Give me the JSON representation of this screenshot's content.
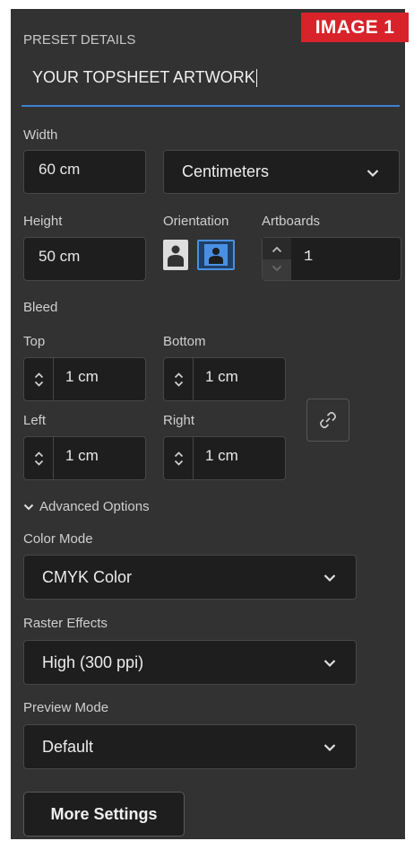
{
  "badge": "IMAGE 1",
  "preset": {
    "header": "PRESET DETAILS",
    "name": "YOUR TOPSHEET ARTWORK"
  },
  "size": {
    "width_label": "Width",
    "width_value": "60 cm",
    "units": "Centimeters",
    "height_label": "Height",
    "height_value": "50 cm",
    "orientation_label": "Orientation",
    "artboards_label": "Artboards",
    "artboards_value": "1"
  },
  "bleed": {
    "label": "Bleed",
    "top_label": "Top",
    "top_value": "1 cm",
    "bottom_label": "Bottom",
    "bottom_value": "1 cm",
    "left_label": "Left",
    "left_value": "1 cm",
    "right_label": "Right",
    "right_value": "1 cm"
  },
  "advanced": {
    "toggle_label": "Advanced Options",
    "color_mode_label": "Color Mode",
    "color_mode_value": "CMYK Color",
    "raster_label": "Raster Effects",
    "raster_value": "High (300 ppi)",
    "preview_label": "Preview Mode",
    "preview_value": "Default"
  },
  "more_settings": "More Settings",
  "colors": {
    "panel_bg": "#323232",
    "field_bg": "#1e1e1e",
    "accent": "#3f7fd1",
    "badge_bg": "#d8232a"
  }
}
